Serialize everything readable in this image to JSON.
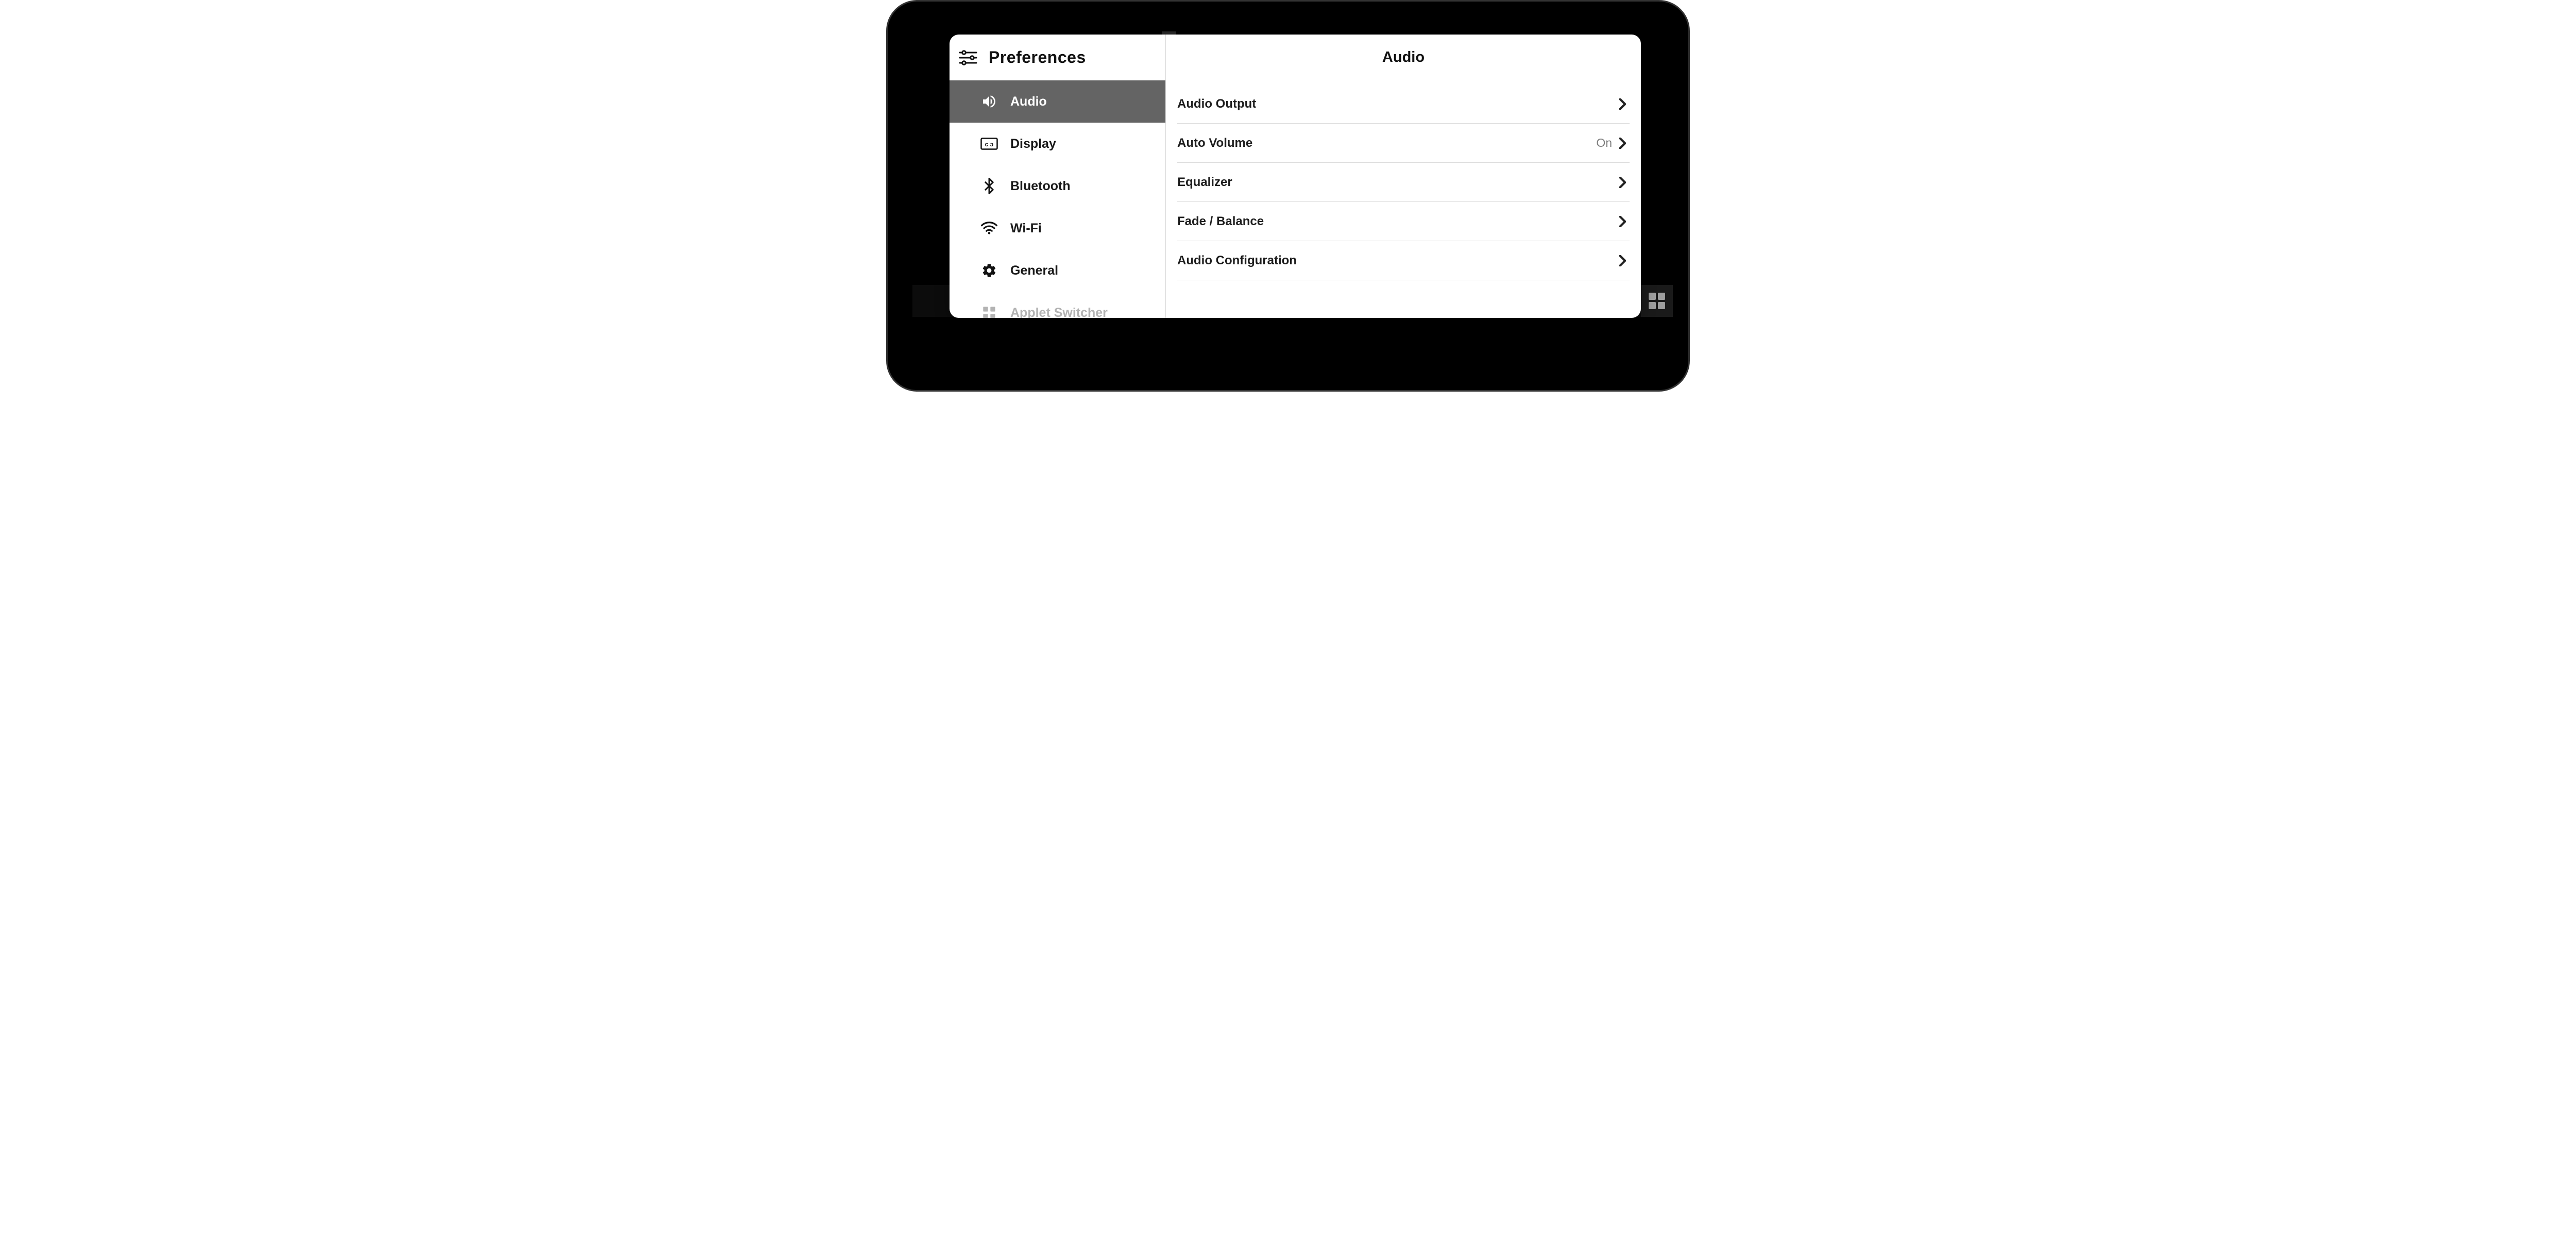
{
  "sidebar": {
    "title": "Preferences",
    "items": [
      {
        "label": "Audio",
        "icon": "speaker-icon",
        "active": true
      },
      {
        "label": "Display",
        "icon": "display-icon"
      },
      {
        "label": "Bluetooth",
        "icon": "bluetooth-icon"
      },
      {
        "label": "Wi-Fi",
        "icon": "wifi-icon"
      },
      {
        "label": "General",
        "icon": "gear-icon"
      },
      {
        "label": "Applet Switcher",
        "icon": "grid-icon",
        "faded": true
      }
    ]
  },
  "content": {
    "title": "Audio",
    "rows": [
      {
        "label": "Audio Output",
        "value": ""
      },
      {
        "label": "Auto Volume",
        "value": "On"
      },
      {
        "label": "Equalizer",
        "value": ""
      },
      {
        "label": "Fade / Balance",
        "value": ""
      },
      {
        "label": "Audio Configuration",
        "value": ""
      }
    ]
  }
}
